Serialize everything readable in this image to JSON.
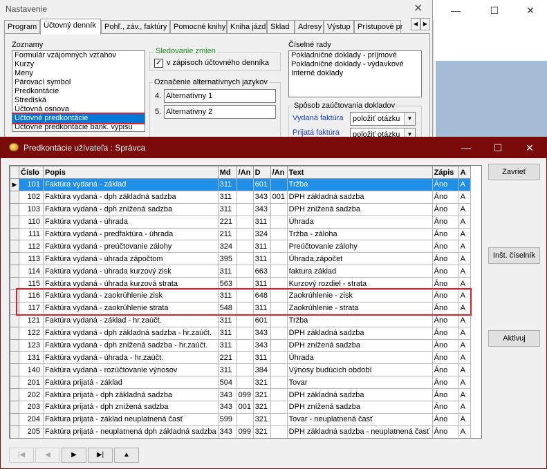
{
  "settings": {
    "title": "Nastavenie",
    "tabs": [
      "Program",
      "Účtovný denník",
      "Pohľ., záv., faktúry",
      "Pomocné knihy",
      "Kniha jázd",
      "Sklad",
      "Adresy",
      "Výstup",
      "Prístupové pr"
    ],
    "active_tab": 1,
    "zoznamy": {
      "label": "Zoznamy",
      "items": [
        "Formulár vzájomných vzťahov",
        "Kurzy",
        "Meny",
        "Párovací symbol",
        "Predkontácie",
        "Strediská",
        "Účtovná osnova",
        "Účtovné predkontácie",
        "Účtovné predkontácie bank. výpisu"
      ],
      "selected": 7
    },
    "sledovanie": {
      "label": "Sledovanie zmien",
      "checkbox_label": "v zápisoch účtovného denníka"
    },
    "alt": {
      "label": "Označenie alternatívnych jazykov",
      "items": [
        {
          "num": "4.",
          "value": "Alternatívny 1"
        },
        {
          "num": "5.",
          "value": "Alternatívny 2"
        }
      ]
    },
    "ciselne": {
      "label": "Číselné rady",
      "items": [
        "Pokladničné doklady - príjmové",
        "Pokladničné doklady - výdavkové",
        "Interné doklady"
      ]
    },
    "sposob": {
      "label": "Spôsob zaúčtovania dokladov",
      "rows": [
        {
          "label": "Vydaná faktúra",
          "value": "položiť otázku"
        },
        {
          "label": "Prijatá faktúra",
          "value": "položiť otázku"
        }
      ]
    }
  },
  "dialog": {
    "title": "Predkontácie užívateľa : Správca",
    "columns": [
      "Číslo",
      "Popis",
      "Md",
      "/An",
      "D",
      "/An",
      "Text",
      "Zápis",
      "A"
    ],
    "rows": [
      [
        "101",
        "Faktúra vydaná - základ",
        "311",
        "",
        "601",
        "",
        "Tržba",
        "Áno",
        "A"
      ],
      [
        "102",
        "Faktúra vydaná - dph základná sadzba",
        "311",
        "",
        "343",
        "001",
        "DPH základná sadzba",
        "Áno",
        "A"
      ],
      [
        "103",
        "Faktúra vydaná - dph znížená sadzba",
        "311",
        "",
        "343",
        "",
        "DPH znížená sadzba",
        "Áno",
        "A"
      ],
      [
        "110",
        "Faktúra vydaná - úhrada",
        "221",
        "",
        "311",
        "",
        "Úhrada",
        "Áno",
        "A"
      ],
      [
        "111",
        "Faktúra vydaná - predfaktúra - úhrada",
        "211",
        "",
        "324",
        "",
        "Tržba - záloha",
        "Áno",
        "A"
      ],
      [
        "112",
        "Faktúra vydaná - preúčtovanie zálohy",
        "324",
        "",
        "311",
        "",
        "Preúčtovanie zálohy",
        "Áno",
        "A"
      ],
      [
        "113",
        "Faktúra vydaná - úhrada zápočtom",
        "395",
        "",
        "311",
        "",
        "Úhrada,zápočet",
        "Áno",
        "A"
      ],
      [
        "114",
        "Faktúra vydaná - úhrada kurzový zisk",
        "311",
        "",
        "663",
        "",
        "faktura základ",
        "Áno",
        "A"
      ],
      [
        "115",
        "Faktúra vydaná - úhrada kurzová strata",
        "563",
        "",
        "311",
        "",
        "Kurzový rozdiel - strata",
        "Áno",
        "A"
      ],
      [
        "116",
        "Faktúra vydaná - zaokrúhlenie zisk",
        "311",
        "",
        "648",
        "",
        "Zaokrúhlenie - zisk",
        "Áno",
        "A"
      ],
      [
        "117",
        "Faktúra vydaná - zaokrúhlenie strata",
        "548",
        "",
        "311",
        "",
        "Zaokrúhlenie - strata",
        "Áno",
        "A"
      ],
      [
        "121",
        "Faktúra vydaná - základ - hr.zaúčt.",
        "311",
        "",
        "601",
        "",
        "Tržba",
        "Áno",
        "A"
      ],
      [
        "122",
        "Faktúra vydaná - dph základná sadzba - hr.zaúčt.",
        "311",
        "",
        "343",
        "",
        "DPH základná sadzba",
        "Áno",
        "A"
      ],
      [
        "123",
        "Faktúra vydaná - dph znížená sadzba - hr.zaúčt.",
        "311",
        "",
        "343",
        "",
        "DPH znížená sadzba",
        "Áno",
        "A"
      ],
      [
        "131",
        "Faktúra vydaná - úhrada - hr.zaúčt.",
        "221",
        "",
        "311",
        "",
        "Úhrada",
        "Áno",
        "A"
      ],
      [
        "140",
        "Faktúra vydaná - rozúčtovanie výnosov",
        "311",
        "",
        "384",
        "",
        "Výnosy budúcich období",
        "Áno",
        "A"
      ],
      [
        "201",
        "Faktúra prijatá - základ",
        "504",
        "",
        "321",
        "",
        "Tovar",
        "Áno",
        "A"
      ],
      [
        "202",
        "Faktúra prijatá - dph základná sadzba",
        "343",
        "099",
        "321",
        "",
        "DPH základná sadzba",
        "Áno",
        "A"
      ],
      [
        "203",
        "Faktúra prijatá - dph znížená sadzba",
        "343",
        "001",
        "321",
        "",
        "DPH znížená sadzba",
        "Áno",
        "A"
      ],
      [
        "204",
        "Faktúra prijatá - základ neuplatnená časť",
        "599",
        "",
        "321",
        "",
        "Tovar - neuplatnená časť",
        "Áno",
        "A"
      ],
      [
        "205",
        "Faktúra prijatá - neuplatnená dph základná sadzba",
        "343",
        "099",
        "321",
        "",
        "DPH základná sadzba - neuplatnená časť",
        "Áno",
        "A"
      ]
    ],
    "selected_row": 0,
    "highlighted_rows": [
      9,
      10
    ],
    "buttons": {
      "close": "Zavrieť",
      "inst": "Inšt. číselník",
      "activate": "Aktivuj"
    },
    "nav": {
      "first": "|◀",
      "prev": "◀",
      "next": "▶",
      "last": "▶|",
      "up": "▲"
    }
  },
  "colors": {
    "dialog_title": "#7b0a0a",
    "selection": "#1f8fe8",
    "highlight": "#e0202a"
  }
}
